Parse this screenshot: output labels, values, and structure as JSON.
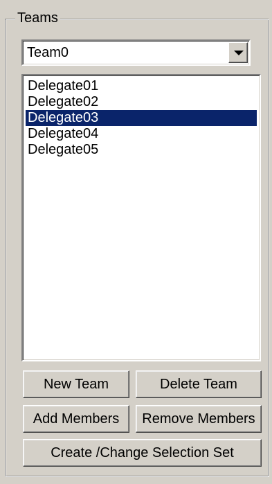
{
  "group": {
    "title": "Teams"
  },
  "team_select": {
    "value": "Team0",
    "icon": "chevron-down-icon"
  },
  "members": {
    "items": [
      {
        "label": "Delegate01",
        "selected": false
      },
      {
        "label": "Delegate02",
        "selected": false
      },
      {
        "label": "Delegate03",
        "selected": true
      },
      {
        "label": "Delegate04",
        "selected": false
      },
      {
        "label": "Delegate05",
        "selected": false
      }
    ],
    "selection_color": "#0a246a"
  },
  "buttons": {
    "new_team": "New Team",
    "delete_team": "Delete Team",
    "add_members": "Add Members",
    "remove_members": "Remove Members",
    "create_selection_set": "Create /Change Selection Set"
  },
  "colors": {
    "face": "#d4d0c8",
    "field": "#ffffff"
  }
}
